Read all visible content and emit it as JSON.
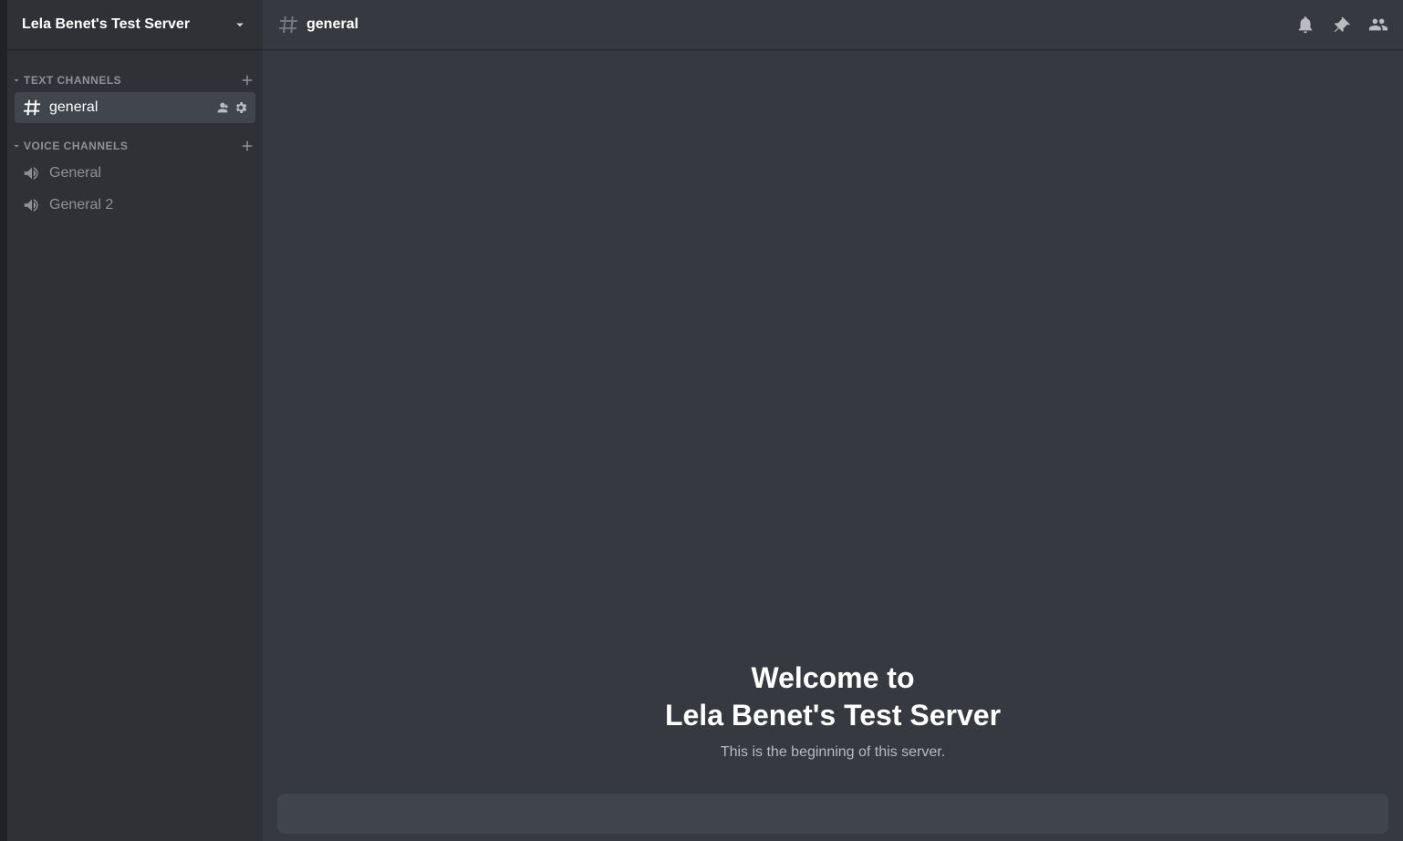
{
  "server": {
    "name": "Lela Benet's Test Server"
  },
  "categories": {
    "text": {
      "label": "TEXT CHANNELS",
      "channels": [
        {
          "name": "general"
        }
      ]
    },
    "voice": {
      "label": "VOICE CHANNELS",
      "channels": [
        {
          "name": "General"
        },
        {
          "name": "General 2"
        }
      ]
    }
  },
  "header": {
    "channel": "general"
  },
  "welcome": {
    "line1": "Welcome to",
    "line2": "Lela Benet's Test Server",
    "subtitle": "This is the beginning of this server."
  }
}
